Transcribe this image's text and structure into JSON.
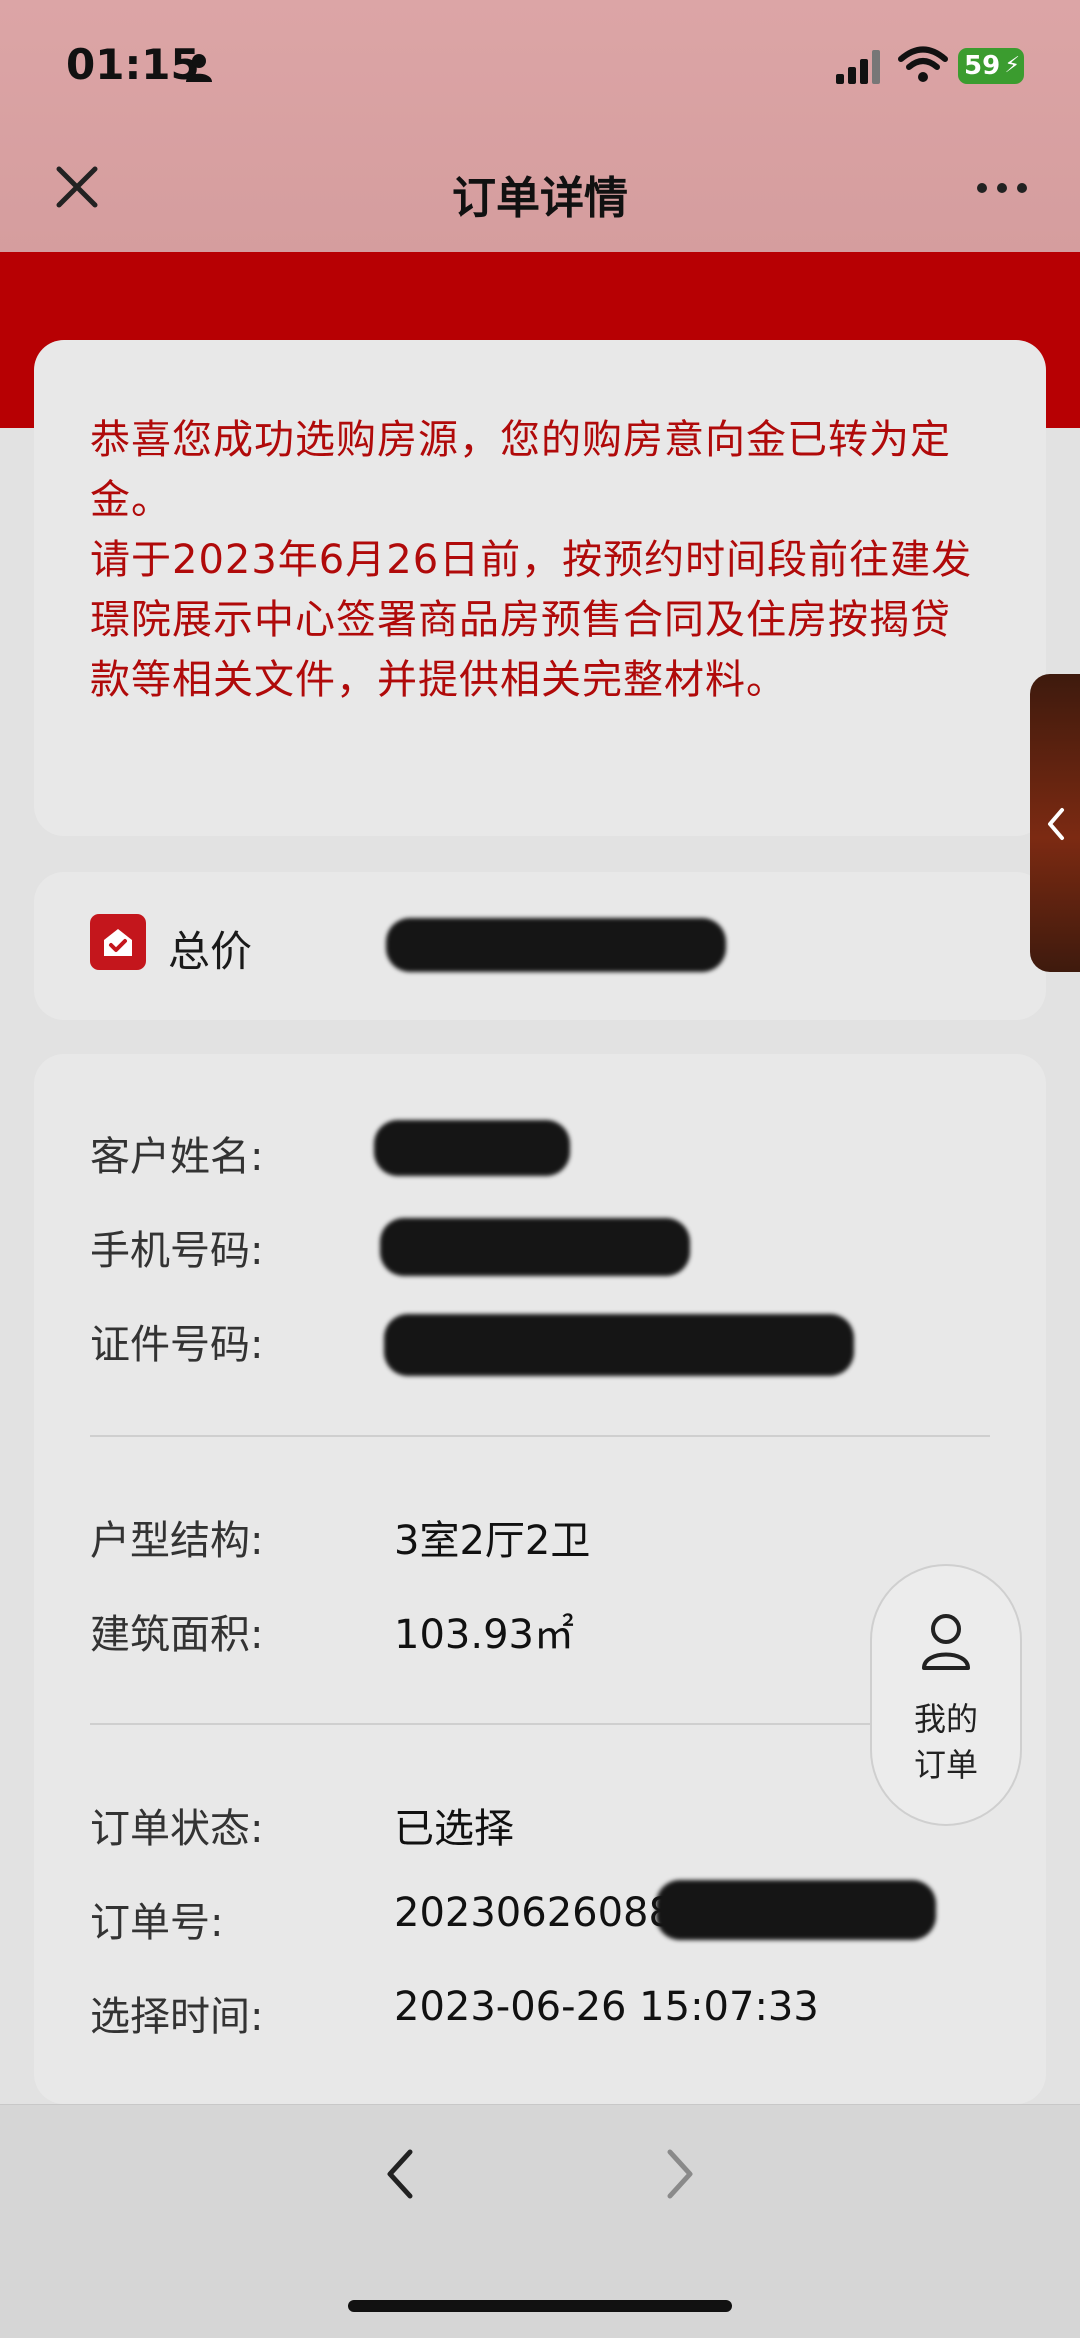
{
  "status_bar": {
    "time": "01:15",
    "battery": "59"
  },
  "header": {
    "title": "订单详情"
  },
  "notice": {
    "text": "恭喜您成功选购房源，您的购房意向金已转为定金。\n请于2023年6月26日前，按预约时间段前往建发璟院展示中心签署商品房预售合同及住房按揭贷款等相关文件，并提供相关完整材料。"
  },
  "price": {
    "label": "总价"
  },
  "customer": {
    "name_label": "客户姓名:",
    "phone_label": "手机号码:",
    "id_label": "证件号码:"
  },
  "house": {
    "layout_label": "户型结构:",
    "layout_value": "3室2厅2卫",
    "area_label": "建筑面积:",
    "area_value": "103.93㎡"
  },
  "order": {
    "status_label": "订单状态:",
    "status_value": "已选择",
    "number_label": "订单号:",
    "number_value_visible": "20230626088",
    "time_label": "选择时间:",
    "time_value": "2023-06-26 15:07:33"
  },
  "float_button": {
    "label_line1": "我的",
    "label_line2": "订单"
  },
  "colors": {
    "accent_red": "#b70003",
    "notice_text": "#b00a0a",
    "header_bg": "#dca5a6"
  }
}
